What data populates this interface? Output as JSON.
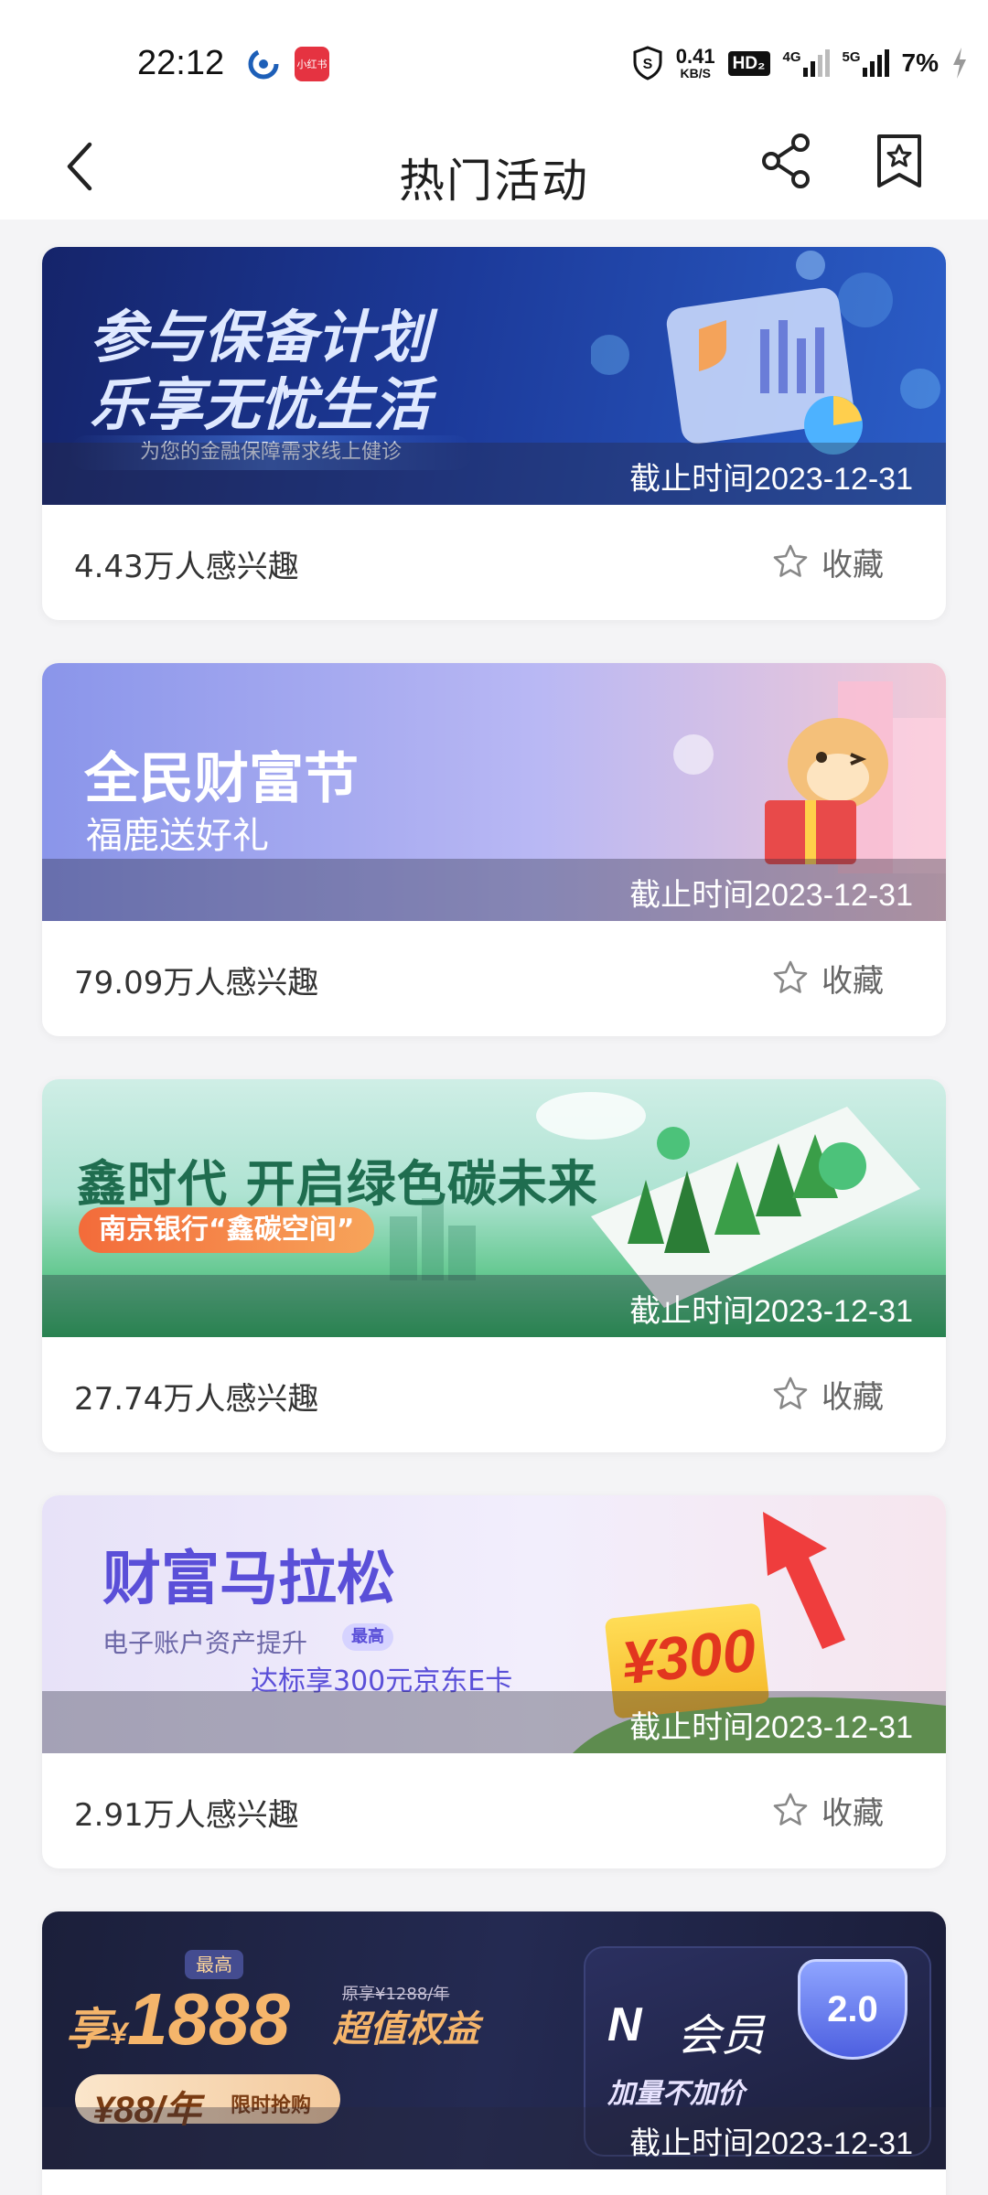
{
  "status_bar": {
    "time": "22:12",
    "app_badge": "小红书",
    "net_speed_value": "0.41",
    "net_speed_unit": "KB/S",
    "hd_label": "HD₂",
    "net1": "4G",
    "net2": "5G",
    "battery": "7%"
  },
  "header": {
    "title": "热门活动",
    "back_icon": "chevron-left-icon",
    "share_icon": "share-icon",
    "favorite_icon": "bookmark-star-icon"
  },
  "cards": [
    {
      "banner": {
        "line1": "参与保备计划",
        "line2": "乐享无忧生活",
        "tag": "为您的金融保障需求线上健诊"
      },
      "deadline": "截止时间2023-12-31",
      "interest": "4.43万人感兴趣",
      "fav_label": "收藏"
    },
    {
      "banner": {
        "line1": "全民财富节",
        "line2": "福鹿送好礼"
      },
      "deadline": "截止时间2023-12-31",
      "interest": "79.09万人感兴趣",
      "fav_label": "收藏"
    },
    {
      "banner": {
        "line1": "鑫时代 开启绿色碳未来",
        "tag": "南京银行“鑫碳空间”"
      },
      "deadline": "截止时间2023-12-31",
      "interest": "27.74万人感兴趣",
      "fav_label": "收藏"
    },
    {
      "banner": {
        "line1": "财富马拉松",
        "line2": "电子账户资产提升",
        "badge": "最高",
        "line3": "达标享300元京东E卡",
        "coupon": "¥300"
      },
      "deadline": "截止时间2023-12-31",
      "interest": "2.91万人感兴趣",
      "fav_label": "收藏"
    },
    {
      "banner": {
        "most": "最高",
        "prefix": "享",
        "currency": "¥",
        "amount": "1888",
        "orig": "原享¥1288/年",
        "super": "超值权益",
        "pill_price": "¥88/年",
        "pill_text": "限时抢购",
        "member_logo": "N",
        "member_label": "会员",
        "member_sub": "加量不加价",
        "version": "2.0"
      },
      "deadline": "截止时间2023-12-31"
    }
  ]
}
